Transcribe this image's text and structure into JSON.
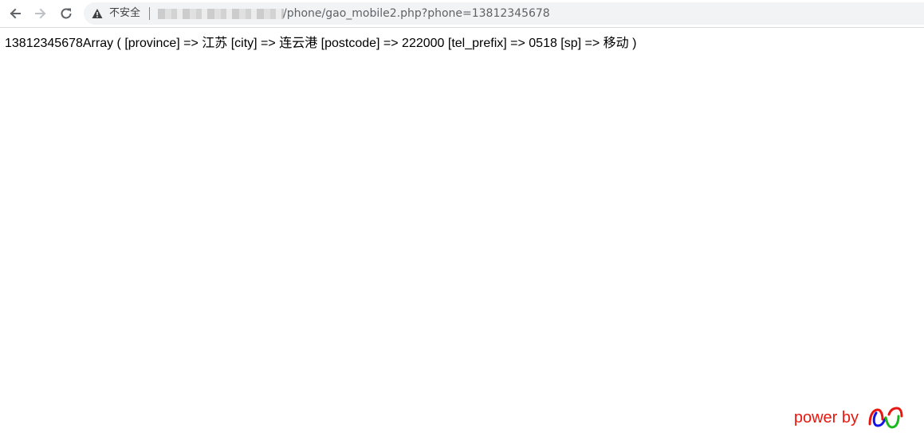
{
  "browser": {
    "back_icon": "arrow-left-icon",
    "forward_icon": "arrow-right-icon",
    "reload_icon": "reload-icon",
    "security_icon": "warning-triangle-icon",
    "security_label": "不安全",
    "url_path": "/phone/gao_mobile2.php?phone=13812345678"
  },
  "page": {
    "output_text": "13812345678Array ( [province] => 江苏 [city] => 连云港 [postcode] => 222000 [tel_prefix] => 0518 [sp] => 移动 )"
  },
  "footer": {
    "power_label": "power by",
    "power_color": "#e8160e",
    "logo_icon": "wavy-logo-icon",
    "logo_colors": [
      "#e8160e",
      "#1414e6",
      "#1ab81a"
    ]
  }
}
